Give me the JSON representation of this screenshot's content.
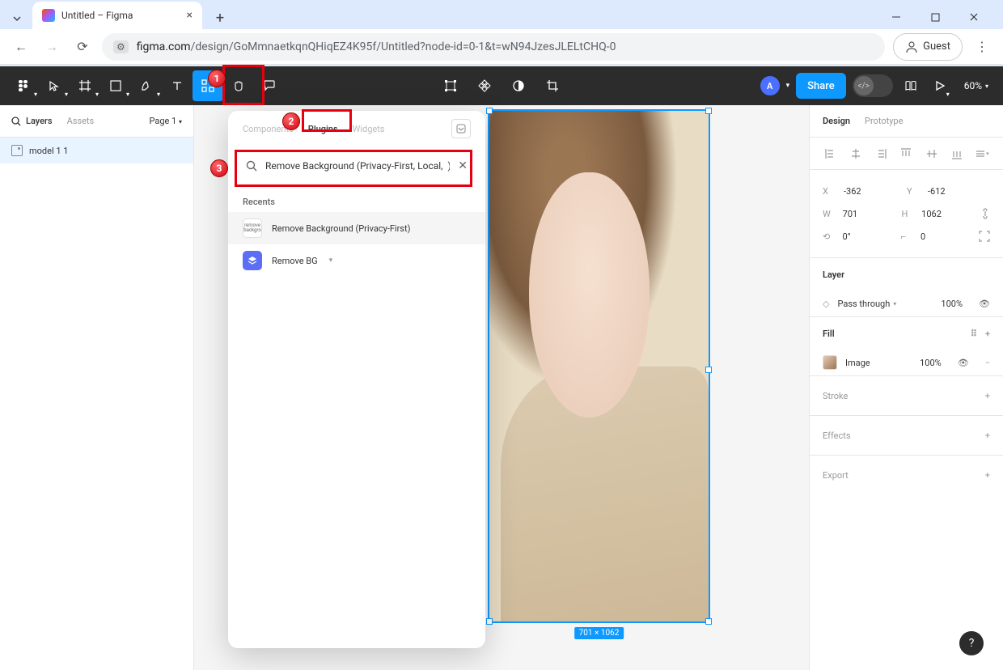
{
  "browser": {
    "tab_title": "Untitled – Figma",
    "url_domain": "figma.com",
    "url_path": "/design/GoMmnaetkqnQHiqEZ4K95f/Untitled?node-id=0-1&t=wN94JzesJLELtCHQ-0",
    "guest_label": "Guest"
  },
  "toolbar": {
    "share_label": "Share",
    "zoom_label": "60%",
    "avatar_letter": "A"
  },
  "left_panel": {
    "tab_layers": "Layers",
    "tab_assets": "Assets",
    "page_label": "Page 1",
    "layer_name": "model 1 1"
  },
  "dropdown": {
    "tab_components": "Components",
    "tab_plugins": "Plugins",
    "tab_widgets": "Widgets",
    "search_value": "Remove Background (Privacy-First, Local,  )",
    "recents_label": "Recents",
    "items": [
      {
        "label": "Remove Background (Privacy-First)"
      },
      {
        "label": "Remove BG"
      }
    ]
  },
  "selection": {
    "dim_label": "701 × 1062"
  },
  "right_panel": {
    "tab_design": "Design",
    "tab_prototype": "Prototype",
    "x_label": "X",
    "x_val": "-362",
    "y_label": "Y",
    "y_val": "-612",
    "w_label": "W",
    "w_val": "701",
    "h_label": "H",
    "h_val": "1062",
    "rot_val": "0°",
    "corner_val": "0",
    "layer_heading": "Layer",
    "blend_mode": "Pass through",
    "opacity": "100%",
    "fill_heading": "Fill",
    "fill_type": "Image",
    "fill_opacity": "100%",
    "stroke_heading": "Stroke",
    "effects_heading": "Effects",
    "export_heading": "Export"
  },
  "callouts": {
    "1": "1",
    "2": "2",
    "3": "3"
  }
}
